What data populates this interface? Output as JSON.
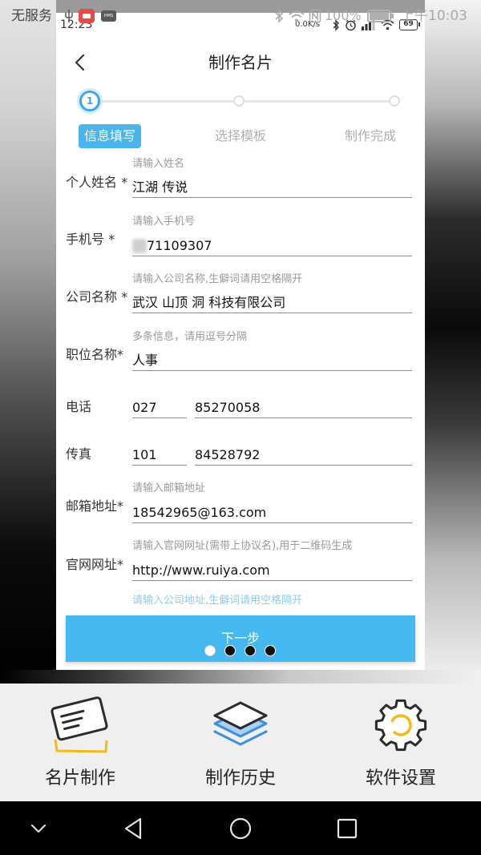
{
  "outer_status": {
    "carrier": "无服务",
    "hms_badge": "HMS",
    "battery": "100%",
    "time": "上午10:03",
    "icons": [
      "usb-icon",
      "app-notification-icon",
      "hms-icon",
      "bluetooth-icon",
      "wifi-icon",
      "nfc-icon",
      "battery-icon"
    ]
  },
  "inner_status": {
    "time": "12:23",
    "net_speed": "0.0K/s",
    "battery": "69",
    "icons": [
      "bluetooth-icon",
      "alarm-icon",
      "signal-icon",
      "wifi-icon",
      "battery-icon"
    ]
  },
  "header": {
    "title": "制作名片",
    "back_icon": "chevron-left-icon"
  },
  "stepper": {
    "current": 1,
    "steps": [
      {
        "number": "1",
        "label": "信息填写"
      },
      {
        "label": "选择模板"
      },
      {
        "label": "制作完成"
      }
    ]
  },
  "form": {
    "name": {
      "label": "个人姓名 *",
      "placeholder": "请输入姓名",
      "value": "江湖 传说"
    },
    "phone": {
      "label": "手机号 *",
      "placeholder": "请输入手机号",
      "value": "71109307"
    },
    "company": {
      "label": "公司名称 *",
      "placeholder": "请输入公司名称,生僻词请用空格隔开",
      "value": "武汉 山顶 洞 科技有限公司"
    },
    "position": {
      "label": "职位名称*",
      "placeholder": "多条信息，请用逗号分隔",
      "value": "人事"
    },
    "tel": {
      "label": "电话",
      "area_code": "027",
      "number": "85270058"
    },
    "fax": {
      "label": "传真",
      "area_code": "101",
      "number": "84528792"
    },
    "email": {
      "label": "邮箱地址*",
      "placeholder": "请输入邮箱地址",
      "value": "18542965@163.com"
    },
    "website": {
      "label": "官网网址*",
      "placeholder": "请输入官网网址(需带上协议名),用于二维码生成",
      "value": "http://www.ruiya.com"
    },
    "address": {
      "placeholder": "请输入公司地址,生僻词请用空格隔开"
    }
  },
  "next_button": {
    "label": "下一步"
  },
  "pager": {
    "total": 4,
    "current": 1
  },
  "bottom_nav": {
    "items": [
      {
        "label": "名片制作",
        "icon": "business-card-icon"
      },
      {
        "label": "制作历史",
        "icon": "layers-icon"
      },
      {
        "label": "软件设置",
        "icon": "gear-icon"
      }
    ]
  },
  "system_nav": {
    "icons": [
      "chevron-down-icon",
      "back-triangle-icon",
      "home-circle-icon",
      "recents-square-icon"
    ]
  },
  "colors": {
    "accent": "#45b9ef",
    "step_active": "#3ba7e8",
    "pill": "#4ab4ec",
    "icon_yellow": "#f2b918",
    "icon_blue": "#3f8fd6",
    "text_dark": "#222222",
    "placeholder": "#999999",
    "bottom_nav_bg": "#efefef"
  }
}
